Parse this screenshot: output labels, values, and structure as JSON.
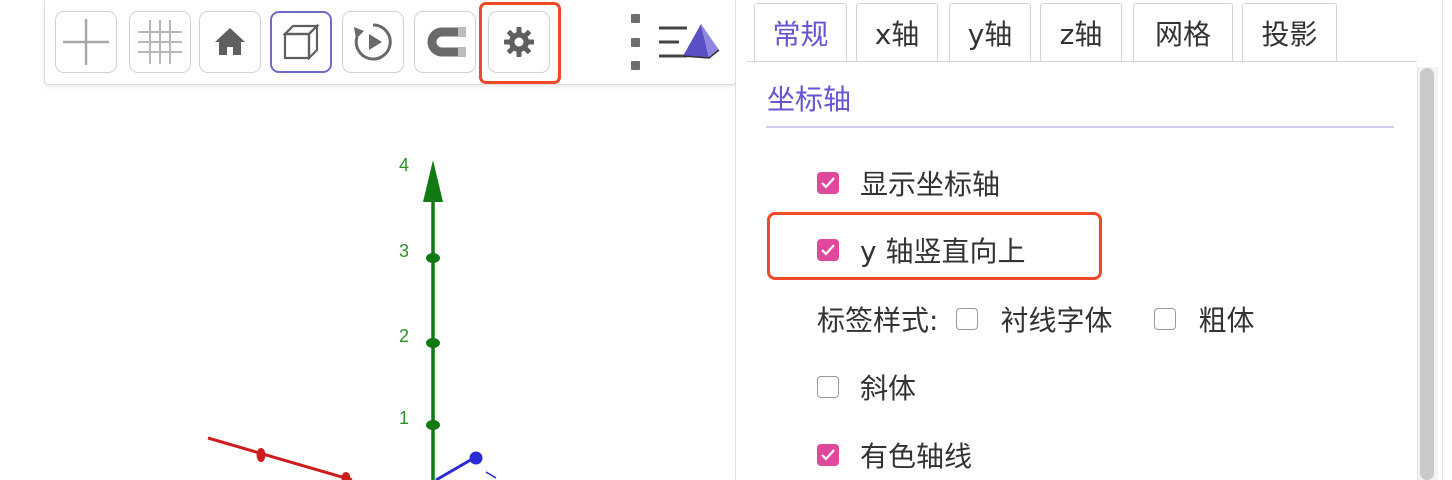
{
  "toolbar": {
    "buttons": [
      {
        "name": "show-axes",
        "icon": "axes-icon",
        "active": false
      },
      {
        "name": "show-grid",
        "icon": "grid-icon",
        "active": false
      },
      {
        "name": "standard-view",
        "icon": "home-icon",
        "active": false
      },
      {
        "name": "show-plane",
        "icon": "cube-icon",
        "active": true
      },
      {
        "name": "rotate-view",
        "icon": "rotate-play-icon",
        "active": false
      },
      {
        "name": "point-capturing",
        "icon": "magnet-icon",
        "active": false
      },
      {
        "name": "settings",
        "icon": "gear-icon",
        "active": false
      }
    ],
    "more_icon": "vertical-dots-icon",
    "view_style_icon": "pyramid-icon"
  },
  "graphics": {
    "z_axis_labels": [
      "1",
      "2",
      "3",
      "4"
    ],
    "colors": {
      "x_axis": "#cc1e1e",
      "y_axis": "#2b2bd6",
      "z_axis": "#127a12",
      "tick_label": "#2f8f2f"
    }
  },
  "settings": {
    "tabs": [
      "常规",
      "x轴",
      "y轴",
      "z轴",
      "网格",
      "投影"
    ],
    "active_tab": "常规",
    "section_title": "坐标轴",
    "options": {
      "show_axes": {
        "label": "显示坐标轴",
        "checked": true
      },
      "y_axis_up": {
        "label": "y 轴竖直向上",
        "checked": true
      },
      "label_style": {
        "label": "标签样式:",
        "serif": {
          "label": "衬线字体",
          "checked": false
        },
        "bold": {
          "label": "粗体",
          "checked": false
        },
        "italic": {
          "label": "斜体",
          "checked": false
        }
      },
      "colored_axes": {
        "label": "有色轴线",
        "checked": true
      }
    },
    "accent_color": "#6557d2",
    "checkbox_color": "#e0489c",
    "highlight_color": "#ef4a27"
  }
}
